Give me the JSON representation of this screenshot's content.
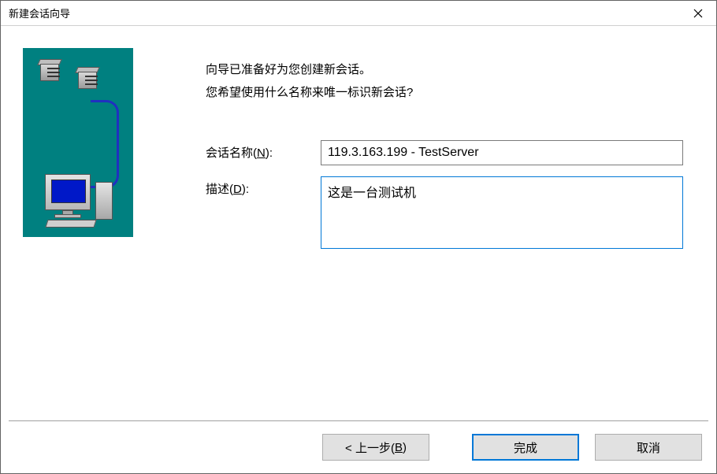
{
  "window": {
    "title": "新建会话向导"
  },
  "intro": {
    "line1": "向导已准备好为您创建新会话。",
    "line2": "您希望使用什么名称来唯一标识新会话?"
  },
  "form": {
    "session_name_label_pre": "会话名称(",
    "session_name_label_key": "N",
    "session_name_label_post": "):",
    "session_name_value": "119.3.163.199 - TestServer",
    "description_label_pre": "描述(",
    "description_label_key": "D",
    "description_label_post": "):",
    "description_value": "这是一台测试机"
  },
  "buttons": {
    "back_pre": "< 上一步(",
    "back_key": "B",
    "back_post": ")",
    "finish": "完成",
    "cancel": "取消"
  }
}
